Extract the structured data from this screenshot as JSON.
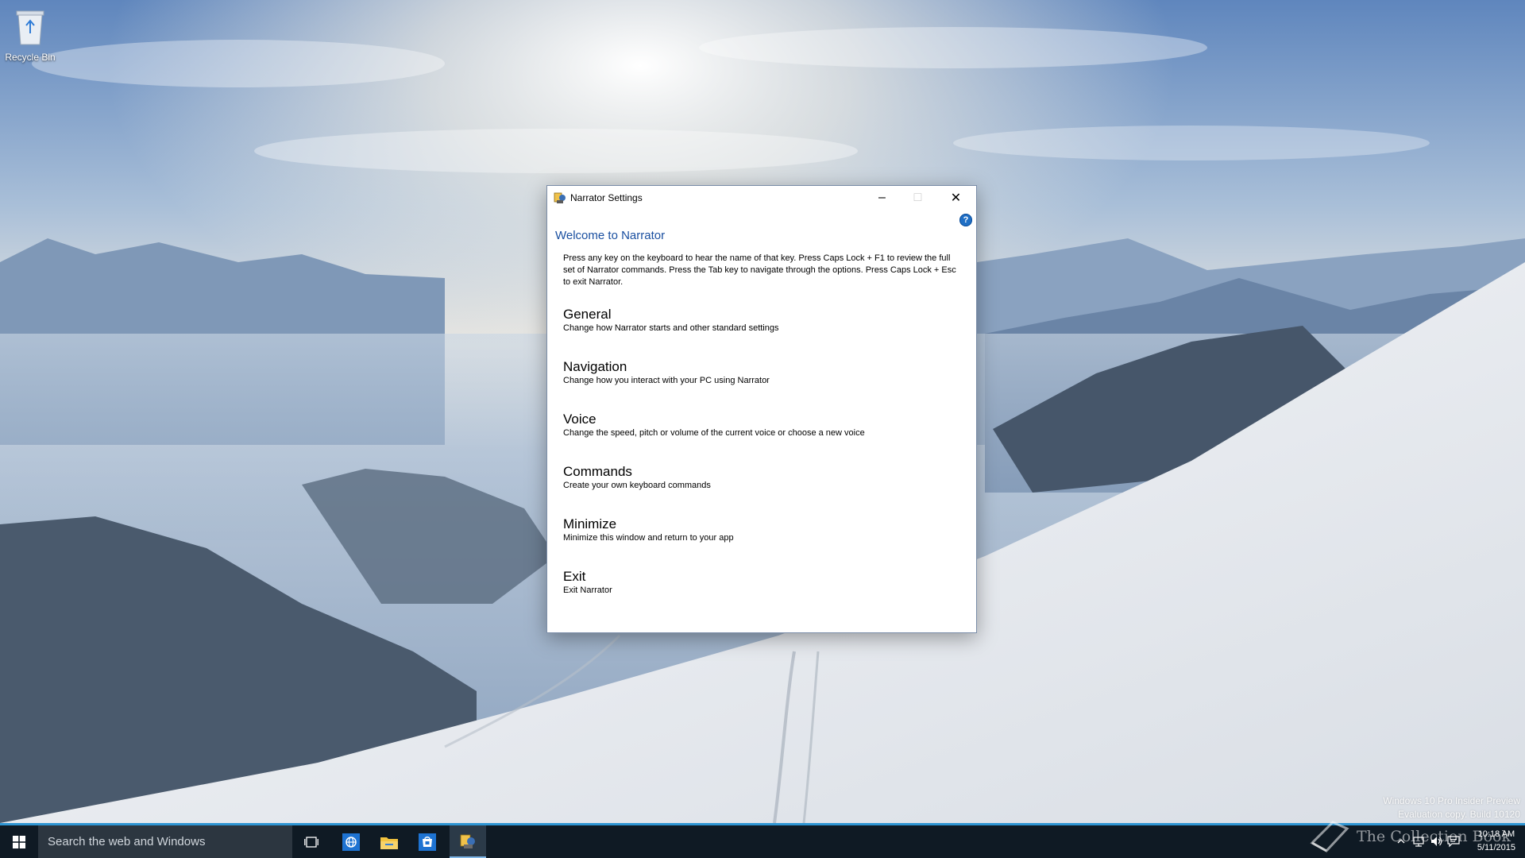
{
  "desktop": {
    "recycle_bin_label": "Recycle Bin",
    "watermark": {
      "line1": "Windows 10 Pro Insider Preview",
      "line2": "Evaluation copy. Build 10120"
    }
  },
  "window": {
    "title": "Narrator Settings",
    "help_symbol": "?",
    "heading": "Welcome to Narrator",
    "intro": "Press any key on the keyboard to hear the name of that key.  Press Caps Lock + F1 to review the full set of Narrator commands.  Press the Tab key to navigate through the options.  Press Caps Lock + Esc to exit Narrator.",
    "menu": [
      {
        "title": "General",
        "description": "Change how Narrator starts and other standard settings"
      },
      {
        "title": "Navigation",
        "description": "Change how you interact with your PC using Narrator"
      },
      {
        "title": "Voice",
        "description": "Change the speed, pitch or volume of the current voice or choose a new voice"
      },
      {
        "title": "Commands",
        "description": "Create your own keyboard commands"
      },
      {
        "title": "Minimize",
        "description": "Minimize this window and return to your app"
      },
      {
        "title": "Exit",
        "description": "Exit Narrator"
      }
    ]
  },
  "taskbar": {
    "search_placeholder": "Search the web and Windows",
    "clock_time": "10:18 AM",
    "clock_date": "5/11/2015",
    "overlay_logo_text": "The Collection Book",
    "accent_color": "#2e95d3"
  }
}
